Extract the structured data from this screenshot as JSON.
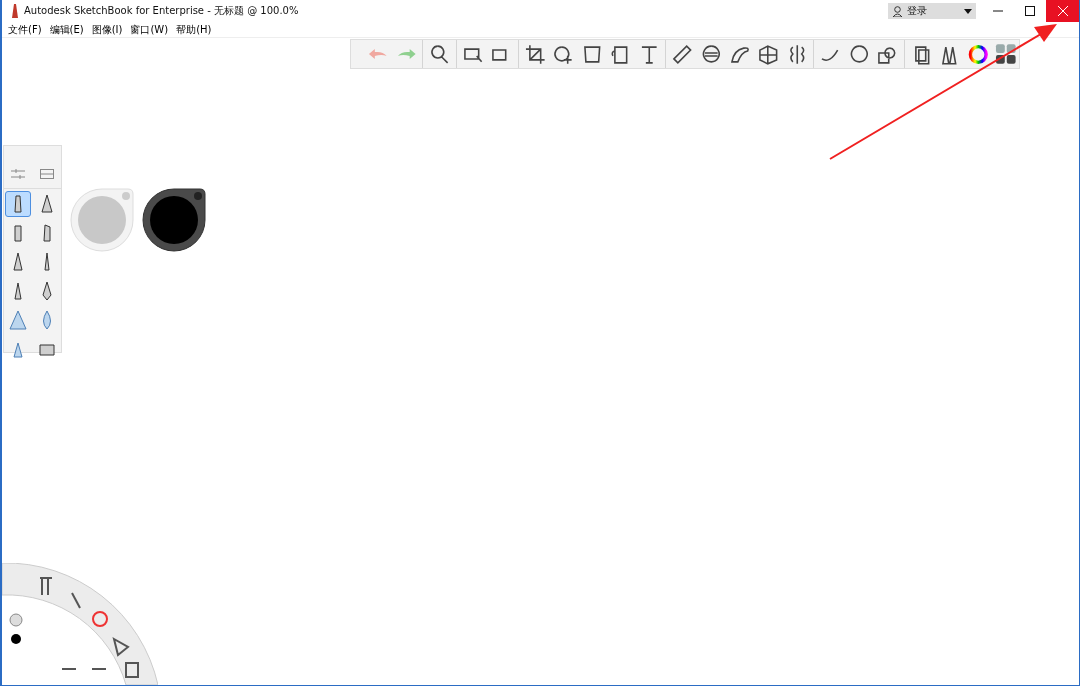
{
  "window": {
    "title": "Autodesk SketchBook for Enterprise - 无标题 @ 100.0%"
  },
  "menu": [
    "文件(F)",
    "编辑(E)",
    "图像(I)",
    "窗口(W)",
    "帮助(H)"
  ],
  "account": {
    "label": "登录"
  },
  "brushes": [
    {
      "selected": true
    },
    {
      "selected": false
    },
    {
      "selected": false
    },
    {
      "selected": false
    },
    {
      "selected": false
    },
    {
      "selected": false
    },
    {
      "selected": false
    },
    {
      "selected": false
    },
    {
      "selected": false
    },
    {
      "selected": false
    },
    {
      "selected": false
    },
    {
      "selected": false
    }
  ],
  "color_pucks": [
    {
      "color": "#c8c8c8"
    },
    {
      "color": "#000000"
    }
  ]
}
